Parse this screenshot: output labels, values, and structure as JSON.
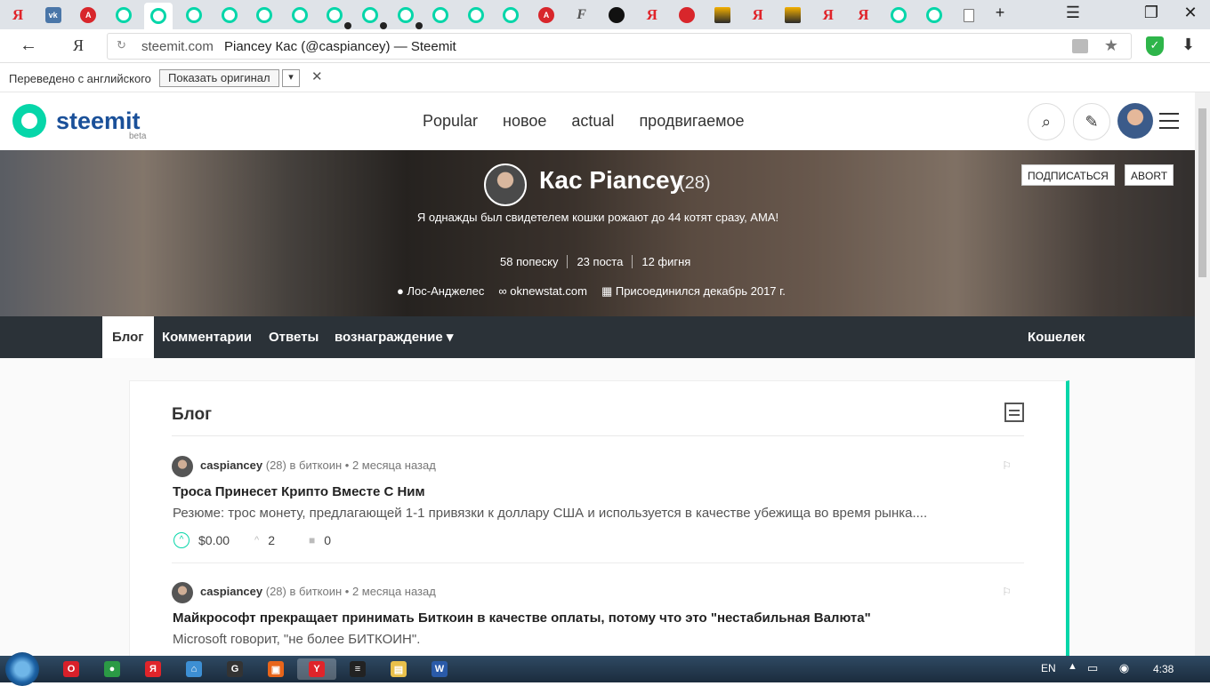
{
  "browser": {
    "tabs": [
      {
        "icon": "yandex-icon",
        "glyph": "Я",
        "cls": "fav-ya"
      },
      {
        "icon": "vk-icon",
        "glyph": "vk",
        "cls": "fav-vk"
      },
      {
        "icon": "red-badge-icon",
        "glyph": "A",
        "cls": "fav-red"
      },
      {
        "icon": "steemit-icon",
        "glyph": "",
        "cls": "fav-steem"
      },
      {
        "icon": "steemit-icon",
        "glyph": "",
        "cls": "fav-steem",
        "active": true
      },
      {
        "icon": "steemit-icon",
        "glyph": "",
        "cls": "fav-steem"
      },
      {
        "icon": "steemit-icon",
        "glyph": "",
        "cls": "fav-steem"
      },
      {
        "icon": "steemit-icon",
        "glyph": "",
        "cls": "fav-steem"
      },
      {
        "icon": "steemit-icon",
        "glyph": "",
        "cls": "fav-steem"
      },
      {
        "icon": "steemit-icon",
        "glyph": "",
        "cls": "fav-steem",
        "dot": true
      },
      {
        "icon": "steemit-icon",
        "glyph": "",
        "cls": "fav-steem",
        "dot": true
      },
      {
        "icon": "steemit-icon",
        "glyph": "",
        "cls": "fav-steem",
        "dot": true
      },
      {
        "icon": "steemit-icon",
        "glyph": "",
        "cls": "fav-steem"
      },
      {
        "icon": "steemit-icon",
        "glyph": "",
        "cls": "fav-steem"
      },
      {
        "icon": "steemit-icon",
        "glyph": "",
        "cls": "fav-steem"
      },
      {
        "icon": "red-badge-icon",
        "glyph": "A",
        "cls": "fav-red"
      },
      {
        "icon": "f-icon",
        "glyph": "F",
        "cls": "fav-f"
      },
      {
        "icon": "github-icon",
        "glyph": "",
        "cls": "fav-gh"
      },
      {
        "icon": "yandex-icon",
        "glyph": "Я",
        "cls": "fav-ya"
      },
      {
        "icon": "red-ball-icon",
        "glyph": "",
        "cls": "fav-red"
      },
      {
        "icon": "picture-icon",
        "glyph": "",
        "cls": "fav-pic"
      },
      {
        "icon": "yandex-icon",
        "glyph": "Я",
        "cls": "fav-ya"
      },
      {
        "icon": "picture-icon",
        "glyph": "",
        "cls": "fav-pic"
      },
      {
        "icon": "yandex-icon",
        "glyph": "Я",
        "cls": "fav-ya"
      },
      {
        "icon": "yandex-icon",
        "glyph": "Я",
        "cls": "fav-ya"
      },
      {
        "icon": "steemit-icon",
        "glyph": "",
        "cls": "fav-steem"
      },
      {
        "icon": "steemit-icon",
        "glyph": "",
        "cls": "fav-steem"
      },
      {
        "icon": "document-icon",
        "glyph": "",
        "cls": "fav-doc"
      }
    ],
    "new_tab": "+",
    "menu_glyph": "☰",
    "restore_glyph": "❐",
    "close_glyph": "✕",
    "back_glyph": "←",
    "yandex_button": "Я",
    "reload_glyph": "↻",
    "domain": "steemit.com",
    "page_title": "Piancey Кас (@caspiancey) — Steemit",
    "star_glyph": "★",
    "shield_glyph": "✓",
    "download_glyph": "⬇"
  },
  "translate_bar": {
    "message": "Переведено с английского",
    "show_original": "Показать оригинал",
    "dropdown": "▾",
    "close": "✕"
  },
  "header": {
    "logo": "steemit",
    "beta": "beta",
    "nav": [
      "Popular",
      "новое",
      "actual",
      "продвигаемое"
    ],
    "search_glyph": "⌕",
    "edit_glyph": "✎"
  },
  "profile": {
    "name": "Кас Piancey",
    "reputation": "(28)",
    "about": "Я однажды был свидетелем кошки рожают до 44 котят сразу, АМА!",
    "stats": [
      "58 попеску",
      "23 поста",
      "12 фигня"
    ],
    "location": "Лос-Анджелес",
    "website": "oknewstat.com",
    "joined": "Присоединился декабрь 2017 г.",
    "location_glyph": "●",
    "link_glyph": "∞",
    "calendar_glyph": "▦",
    "follow_label": "ПОДПИСАТЬСЯ",
    "abort_label": "ABORT"
  },
  "tabs": {
    "blog": "Блог",
    "comments": "Комментарии",
    "replies": "Ответы",
    "rewards": "вознаграждение ▾",
    "wallet": "Кошелек"
  },
  "blog": {
    "title": "Блог",
    "posts": [
      {
        "author": "caspiancey",
        "rep": "(28)",
        "meta": "в биткоин • 2 месяца назад",
        "title": "Троса Принесет Крипто Вместе С Ним",
        "summary": "Резюме: трос монету, предлагающей 1-1 привязки к доллару США и используется в качестве убежища во время рынка....",
        "payout": "$0.00",
        "votes": "2",
        "comments": "0"
      },
      {
        "author": "caspiancey",
        "rep": "(28)",
        "meta": "в биткоин • 2 месяца назад",
        "title": "Майкрософт прекращает принимать Биткоин в качестве оплаты, потому что это \"нестабильная Валюта\"",
        "summary": "Microsoft говорит, \"не более БИТКОИН\"."
      }
    ],
    "up_glyph": "^",
    "flag_glyph": "⚐",
    "comment_glyph": "■"
  },
  "taskbar": {
    "apps": [
      {
        "name": "opera-icon",
        "glyph": "O",
        "color": "#d8202a"
      },
      {
        "name": "chrome-icon",
        "glyph": "●",
        "color": "#2b9a45"
      },
      {
        "name": "yandex-browser-icon",
        "glyph": "Я",
        "color": "#e0242a"
      },
      {
        "name": "home-icon",
        "glyph": "⌂",
        "color": "#3d8fd4"
      },
      {
        "name": "game-icon",
        "glyph": "G",
        "color": "#333"
      },
      {
        "name": "store-icon",
        "glyph": "▣",
        "color": "#e8651a"
      },
      {
        "name": "yandex-active-icon",
        "glyph": "Y",
        "color": "#e0242a",
        "active": true
      },
      {
        "name": "flag-app-icon",
        "glyph": "≡",
        "color": "#222"
      },
      {
        "name": "explorer-icon",
        "glyph": "▤",
        "color": "#e9c04b"
      },
      {
        "name": "word-icon",
        "glyph": "W",
        "color": "#2a5aa8"
      }
    ],
    "lang": "EN",
    "tray_arrow": "▲",
    "tray_icons": "▭ ◉",
    "time": "4:38"
  },
  "colors": {
    "accent": "#06d6a9",
    "logo_blue": "#1a5099",
    "tabs_bg": "#2b3238"
  }
}
